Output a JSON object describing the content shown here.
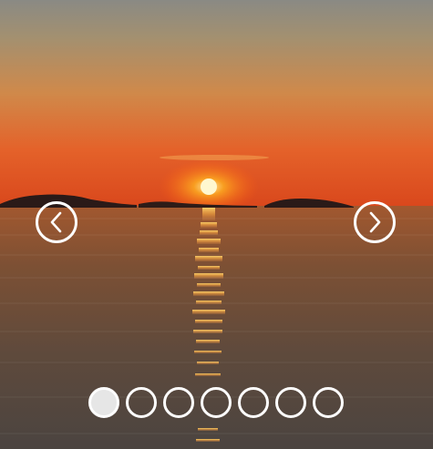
{
  "slider": {
    "current_index": 0,
    "slide_count": 7,
    "slide_image": "sunset-over-sea",
    "prev_icon": "chevron-left-icon",
    "next_icon": "chevron-right-icon",
    "dots": [
      {
        "active": true
      },
      {
        "active": false
      },
      {
        "active": false
      },
      {
        "active": false
      },
      {
        "active": false
      },
      {
        "active": false
      },
      {
        "active": false
      }
    ]
  },
  "colors": {
    "control": "#ffffff",
    "active_dot": "#e6e6e6"
  }
}
